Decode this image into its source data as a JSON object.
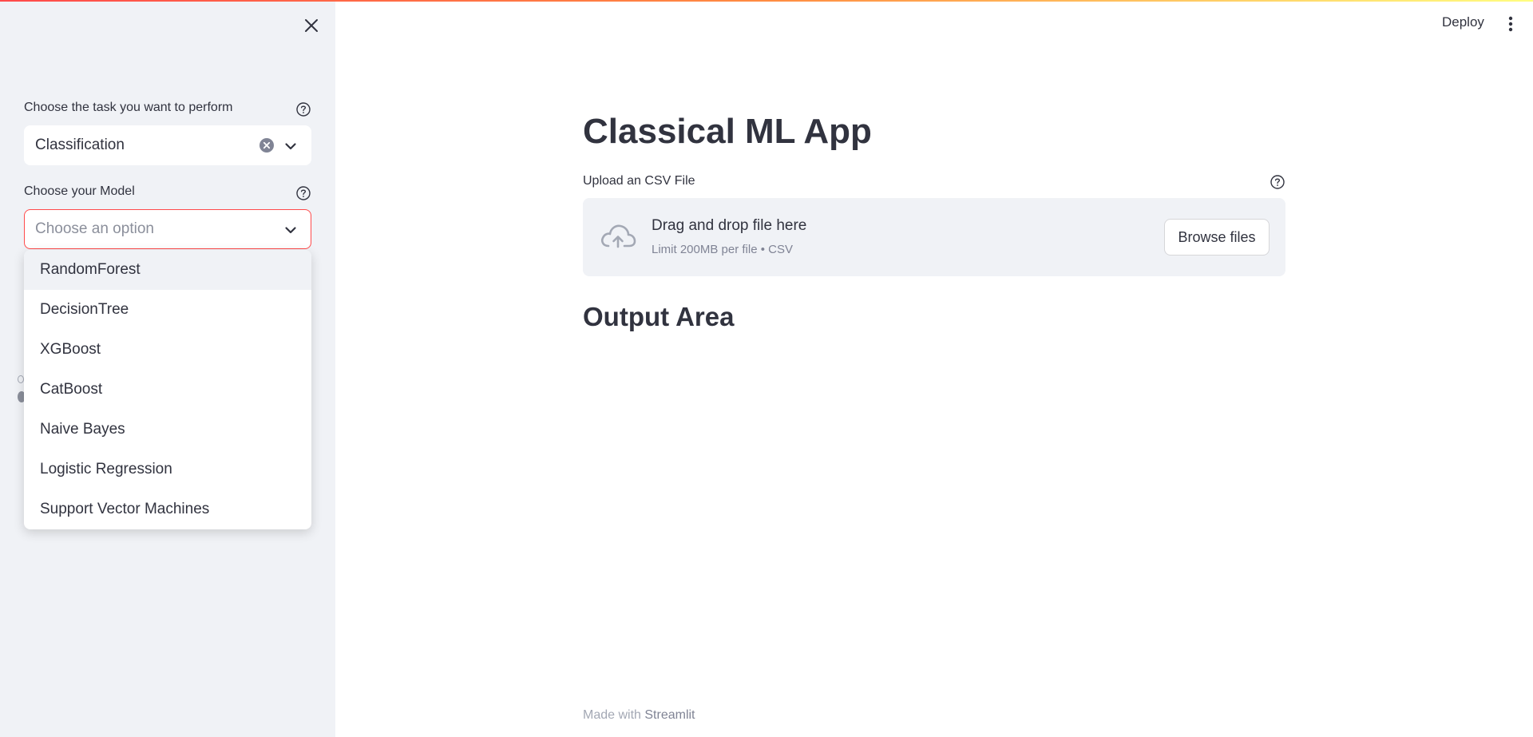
{
  "colors": {
    "accent": "#ff4b4b",
    "sidebar_bg": "#f0f2f6",
    "text": "#31333f",
    "muted": "#808495"
  },
  "sidebar": {
    "close_icon": "close-icon",
    "task_label": "Choose the task you want to perform",
    "task_value": "Classification",
    "model_label": "Choose your Model",
    "model_placeholder": "Choose an option",
    "model_options": [
      "RandomForest",
      "DecisionTree",
      "XGBoost",
      "CatBoost",
      "Naive Bayes",
      "Logistic Regression",
      "Support Vector Machines"
    ]
  },
  "header": {
    "deploy_label": "Deploy",
    "menu_icon": "more-vertical-icon"
  },
  "main": {
    "title": "Classical ML App",
    "upload_label": "Upload an CSV File",
    "dropzone_title": "Drag and drop file here",
    "dropzone_subtitle": "Limit 200MB per file • CSV",
    "browse_label": "Browse files",
    "output_title": "Output Area"
  },
  "footer": {
    "prefix": "Made with ",
    "brand": "Streamlit"
  }
}
